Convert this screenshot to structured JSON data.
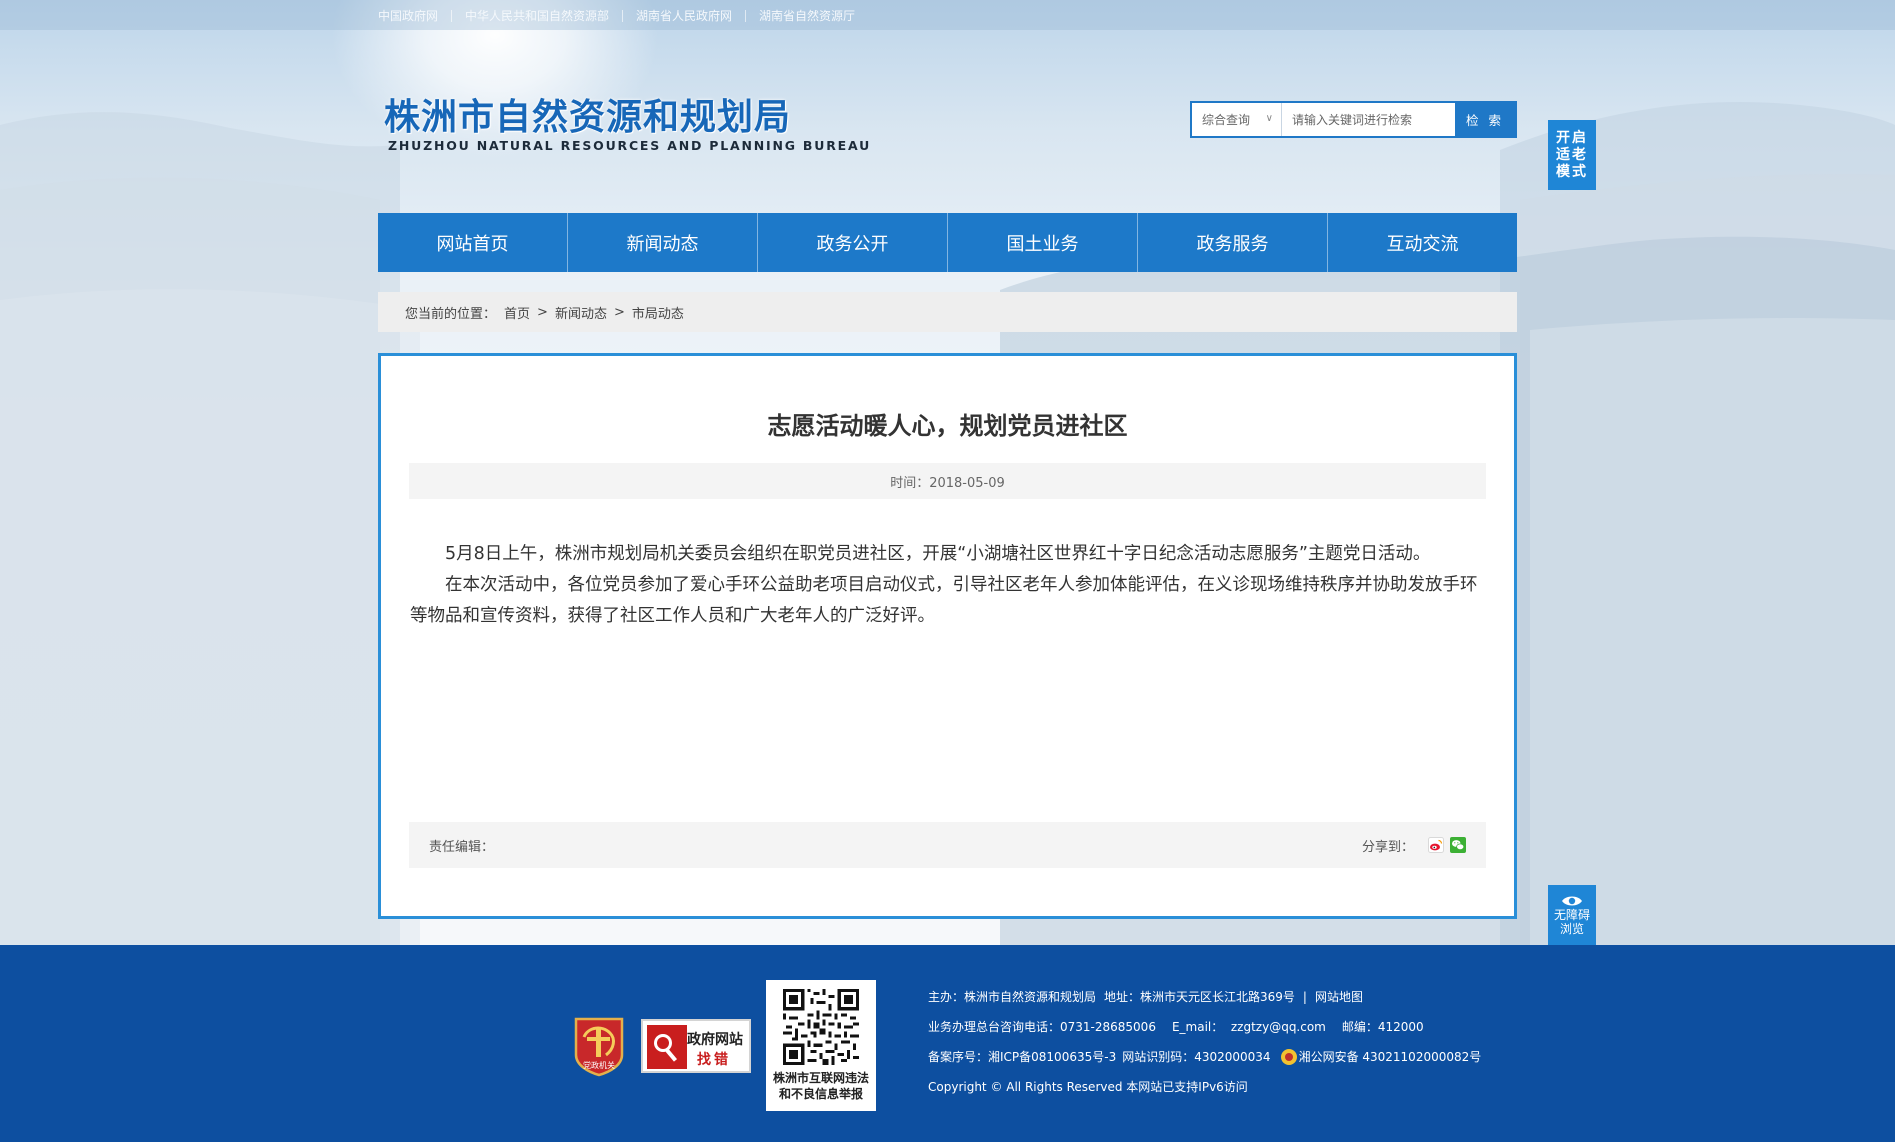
{
  "top_links": [
    "中国政府网",
    "中华人民共和国自然资源部",
    "湖南省人民政府网",
    "湖南省自然资源厅"
  ],
  "logo": {
    "cn": "株洲市自然资源和规划局",
    "en": "ZHUZHOU NATURAL RESOURCES AND PLANNING BUREAU"
  },
  "search": {
    "scope": "综合查询",
    "placeholder": "请输入关键词进行检索",
    "button": "检 索"
  },
  "elder_mode": [
    "开启",
    "适老",
    "模式"
  ],
  "accessibility": [
    "无障碍",
    "浏览"
  ],
  "nav": [
    "网站首页",
    "新闻动态",
    "政务公开",
    "国土业务",
    "政务服务",
    "互动交流"
  ],
  "breadcrumb": {
    "label": "您当前的位置：",
    "items": [
      "首页",
      "新闻动态",
      "市局动态"
    ],
    "sep": ">"
  },
  "article": {
    "title": "志愿活动暖人心，规划党员进社区",
    "time": "时间：2018-05-09",
    "paragraphs": [
      "5月8日上午，株洲市规划局机关委员会组织在职党员进社区，开展“小湖塘社区世界红十字日纪念活动志愿服务”主题党日活动。",
      "在本次活动中，各位党员参加了爱心手环公益助老项目启动仪式，引导社区老年人参加体能评估，在义诊现场维持秩序并协助发放手环等物品和宣传资料，获得了社区工作人员和广大老年人的广泛好评。"
    ],
    "editor": "责任编辑：",
    "share_label": "分享到："
  },
  "footer": {
    "party_badge": "党政机关",
    "error_badge": [
      "政府网站",
      "找错"
    ],
    "qr_caption": [
      "株洲市互联网违法",
      "和不良信息举报"
    ],
    "row1": {
      "host": "主办：株洲市自然资源和规划局",
      "address": "地址：株洲市天元区长江北路369号",
      "sep": "|",
      "sitemap": "网站地图"
    },
    "row2": {
      "phone": "业务办理总台咨询电话：0731-28685006",
      "email": "E_mail：  zzgtzy@qq.com",
      "zip": "邮编：412000"
    },
    "row3": {
      "icp": "备案序号：湘ICP备08100635号-3",
      "site_id": "网站识别码：4302000034",
      "police": "湘公网安备 43021102000082号"
    },
    "copyright": "Copyright © All Rights Reserved 本网站已支持IPv6访问"
  },
  "colors": {
    "primary": "#1d79c9",
    "footer": "#0d4fa0",
    "content_border": "#2a8fd8",
    "logo": "#1767b8"
  }
}
